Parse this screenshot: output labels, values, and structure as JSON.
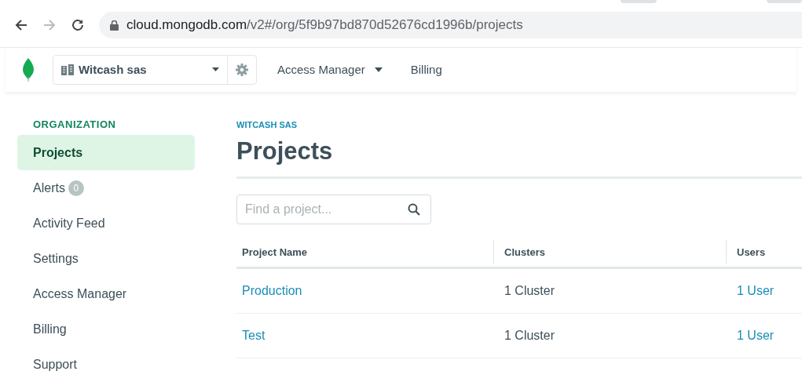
{
  "browser": {
    "url_host": "cloud.mongodb.com",
    "url_path": "/v2#/org/5f9b97bd870d52676cd1996b/projects"
  },
  "header": {
    "org_name": "Witcash sas",
    "nav": [
      {
        "label": "Access Manager",
        "has_menu": true
      },
      {
        "label": "Billing",
        "has_menu": false
      }
    ]
  },
  "sidebar": {
    "heading": "ORGANIZATION",
    "items": [
      {
        "label": "Projects",
        "selected": true
      },
      {
        "label": "Alerts",
        "selected": false,
        "badge": "0"
      },
      {
        "label": "Activity Feed",
        "selected": false
      },
      {
        "label": "Settings",
        "selected": false
      },
      {
        "label": "Access Manager",
        "selected": false
      },
      {
        "label": "Billing",
        "selected": false
      },
      {
        "label": "Support",
        "selected": false
      }
    ]
  },
  "main": {
    "breadcrumb": "WITCASH SAS",
    "title": "Projects",
    "search": {
      "placeholder": "Find a project..."
    },
    "table": {
      "columns": [
        "Project Name",
        "Clusters",
        "Users"
      ],
      "rows": [
        [
          "Production",
          "1 Cluster",
          "1 User"
        ],
        [
          "Test",
          "1 Cluster",
          "1 User"
        ]
      ]
    }
  }
}
